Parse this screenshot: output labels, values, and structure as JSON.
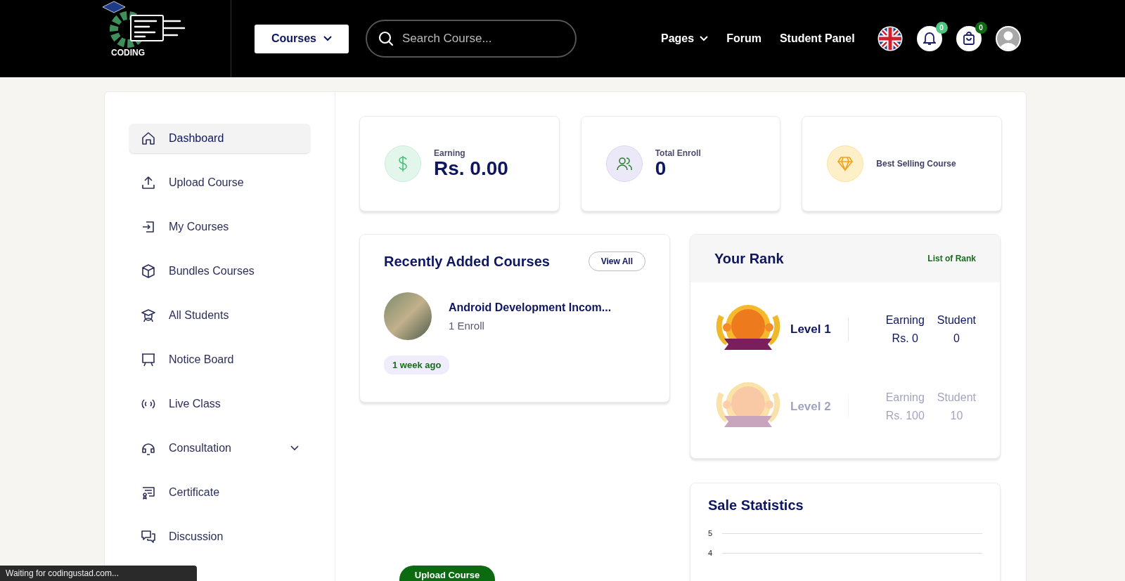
{
  "header": {
    "logo_text": "CODING",
    "courses_button": "Courses",
    "search": {
      "placeholder": "Search Course..."
    },
    "nav": [
      {
        "label": "Pages",
        "dropdown": true
      },
      {
        "label": "Forum",
        "dropdown": false
      },
      {
        "label": "Student Panel",
        "dropdown": false
      }
    ],
    "notifications_count": "0",
    "cart_count": "0"
  },
  "sidebar": {
    "items": [
      {
        "label": "Dashboard",
        "selected": true,
        "expandable": false
      },
      {
        "label": "Upload Course",
        "selected": false,
        "expandable": false
      },
      {
        "label": "My Courses",
        "selected": false,
        "expandable": false
      },
      {
        "label": "Bundles Courses",
        "selected": false,
        "expandable": false
      },
      {
        "label": "All Students",
        "selected": false,
        "expandable": false
      },
      {
        "label": "Notice Board",
        "selected": false,
        "expandable": false
      },
      {
        "label": "Live Class",
        "selected": false,
        "expandable": false
      },
      {
        "label": "Consultation",
        "selected": false,
        "expandable": true
      },
      {
        "label": "Certificate",
        "selected": false,
        "expandable": false
      },
      {
        "label": "Discussion",
        "selected": false,
        "expandable": false
      }
    ]
  },
  "stats": [
    {
      "kind": "earning",
      "label": "Earning",
      "value": "Rs. 0.00"
    },
    {
      "kind": "enroll",
      "label": "Total Enroll",
      "value": "0"
    },
    {
      "kind": "best",
      "label": "Best Selling Course"
    }
  ],
  "recent_courses": {
    "title": "Recently Added Courses",
    "view_all": "View All",
    "items": [
      {
        "title": "Android Development Incom...",
        "enrolls": "1 Enroll",
        "time": "1 week ago"
      }
    ]
  },
  "rank": {
    "title": "Your Rank",
    "link": "List of Rank",
    "levels": [
      {
        "name": "Level 1",
        "achieved": true,
        "earning_label": "Earning",
        "earning": "Rs. 0",
        "student_label": "Student",
        "students": "0"
      },
      {
        "name": "Level 2",
        "achieved": false,
        "earning_label": "Earning",
        "earning": "Rs. 100",
        "student_label": "Student",
        "students": "10"
      }
    ]
  },
  "sale_statistics": {
    "title": "Sale Statistics",
    "y_labels": [
      "5",
      "4"
    ]
  },
  "floating_button": "Upload Course",
  "status_bar": "Waiting for codingustad.com..."
}
